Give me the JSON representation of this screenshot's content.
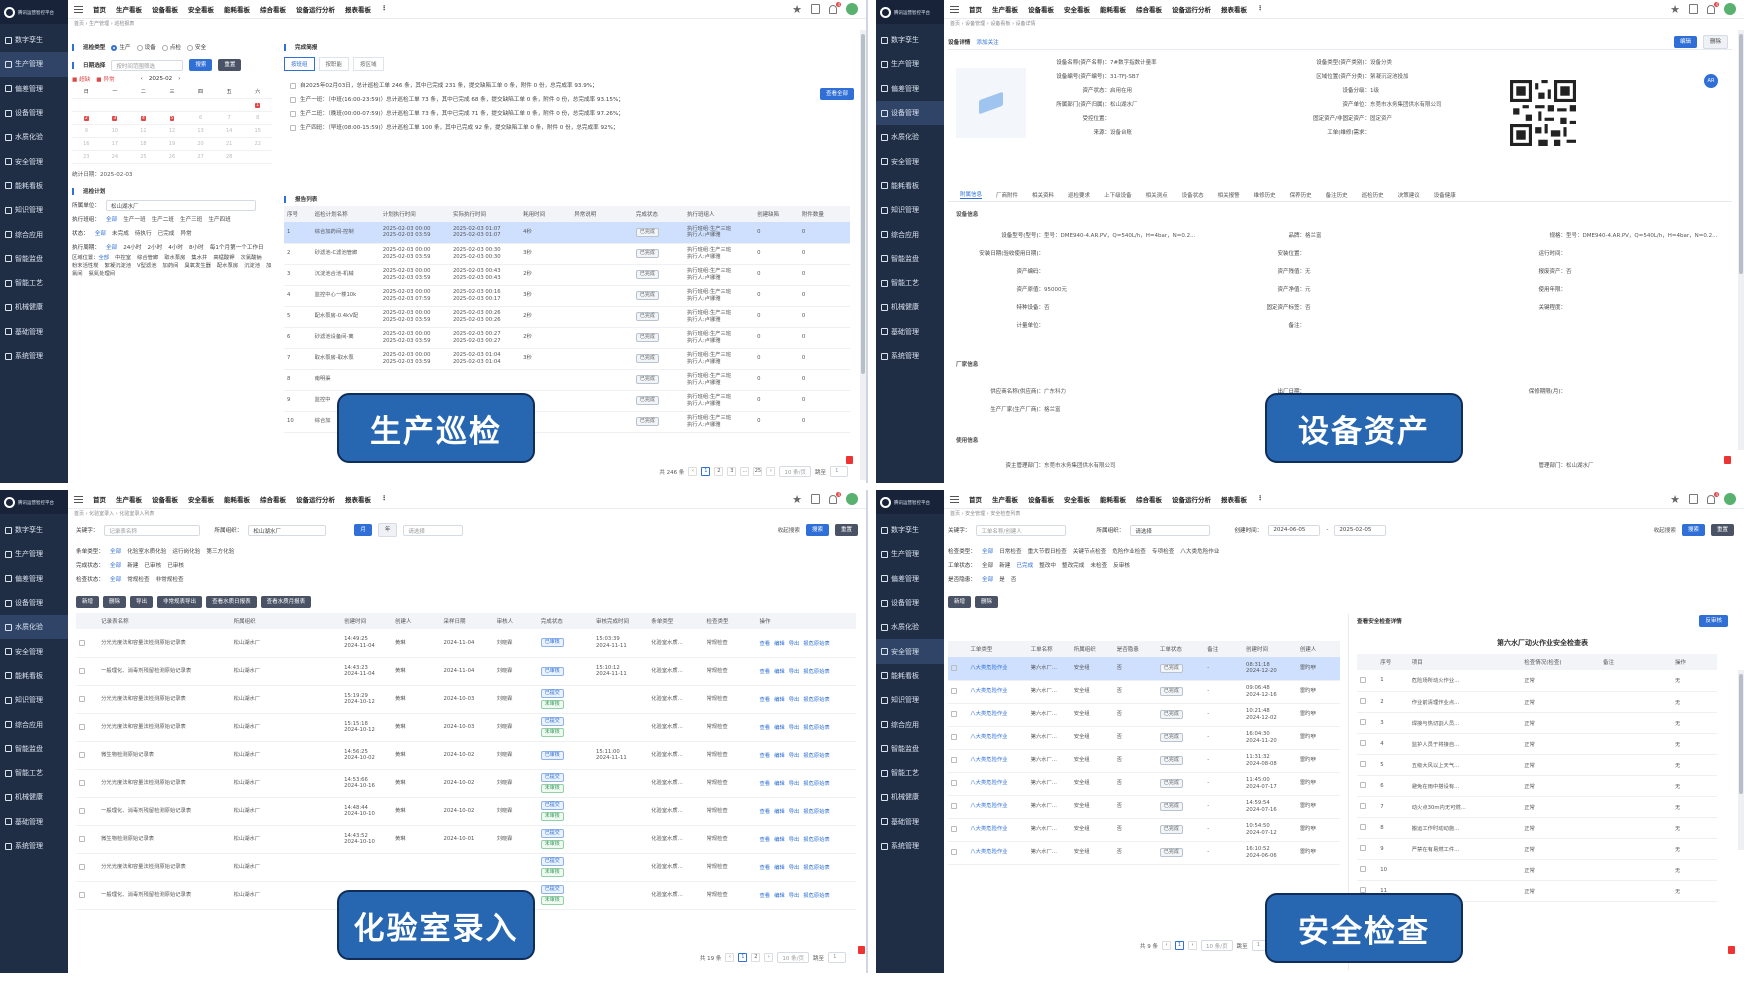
{
  "common": {
    "brand": "腾讯运营智控平台",
    "nav": [
      "数字孪生",
      "生产管理",
      "偏差管理",
      "设备管理",
      "水质化验",
      "安全管理",
      "能耗看板",
      "知识管理",
      "综合应用",
      "智能监盘",
      "智能工艺",
      "机械健康",
      "基础管理",
      "系统管理"
    ],
    "top_menu": [
      "首页",
      "生产看板",
      "设备看板",
      "安全看板",
      "能耗看板",
      "综合看板",
      "设备运行分析",
      "报表看板",
      "⋮"
    ],
    "bell_count": "4"
  },
  "q1": {
    "label": "生产巡检",
    "crumb": "首页 › 生产管理 › 巡检报表",
    "filter_title": "巡检类型",
    "type_opts": [
      "生产",
      "设备",
      "点检",
      "安全"
    ],
    "date_title": "日期选择",
    "date_placeholder": "按时间范围筛选",
    "search": "搜索",
    "reset": "重置",
    "legend": [
      "超缺",
      "异常"
    ],
    "month": "2025-02",
    "weekdays": [
      "日",
      "一",
      "二",
      "三",
      "四",
      "五",
      "六"
    ],
    "days": [
      "",
      "",
      "",
      "",
      "",
      "",
      "1",
      "2",
      "3",
      "4",
      "5",
      "6",
      "7",
      "8",
      "9",
      "10",
      "11",
      "12",
      "13",
      "14",
      "15",
      "16",
      "17",
      "18",
      "19",
      "20",
      "21",
      "22",
      "23",
      "24",
      "25",
      "26",
      "27",
      "28",
      ""
    ],
    "marked_days": [
      "1",
      "2",
      "3",
      "4",
      "5"
    ],
    "selected_date": "统计日期：2025-02-03",
    "plan_title": "巡检计划",
    "org_label": "所属单位：",
    "org_value": "松山湖水厂",
    "team_label": "执行班组：",
    "teams": [
      "全部",
      "生产一班",
      "生产二班",
      "生产三班",
      "生产四班"
    ],
    "state_label": "状态：",
    "states": [
      "全部",
      "未完成",
      "待执行",
      "已完成",
      "异常"
    ],
    "period_label": "执行周期：",
    "periods": [
      "全部",
      "24小时",
      "2小时",
      "4小时",
      "8小时",
      "每1个月第一个工作日"
    ],
    "area_label": "区域位置：",
    "areas": [
      "全部",
      "中控室",
      "综合管廊",
      "取水泵房",
      "集水井",
      "高锰酸钾",
      "次氯酸钠",
      "粉末活性炭",
      "絮凝沉淀池",
      "V型滤池",
      "加药间",
      "臭氧发生器",
      "配水泵房",
      "沉淀池",
      "加氯间",
      "氨氮处理间"
    ],
    "report_title": "完成简报",
    "report_tabs": [
      "按班组",
      "按职能",
      "按区域"
    ],
    "summary_lines": [
      "自2025年02月03日，总计巡检工单 246 条，其中已完成 231 条，提交缺陷工单 0 条，附件 0 份，总完成率 93.9%；",
      "生产一班：（中班(16:00-23:59)）总计巡检工单 73 条，其中已完成 68 条，提交缺陷工单 0 条，附件 0 份，总完成率 93.15%；",
      "生产二班：（晚班(00:00-07:59)）总计巡检工单 73 条，其中已完成 71 条，提交缺陷工单 0 条，附件 0 份，总完成率 97.26%；",
      "生产四班：（早班(08:00-15:59)）总计巡检工单 100 条，其中已完成 92 条，提交缺陷工单 0 条，附件 0 份，总完成率 92%；"
    ],
    "view_all": "查看全部",
    "list_title": "报告列表",
    "columns": [
      "序号",
      "巡检计划名称",
      "计划执行时间",
      "实际执行时间",
      "耗用时间",
      "异常说明",
      "完成状态",
      "执行班组人",
      "创建缺陷",
      "附件数量"
    ],
    "rows": [
      [
        "1",
        "综合加药间-控制",
        "2025-02-03 00:00\n2025-02-03 03:59",
        "2025-02-03 01:07\n2025-02-03 01:07",
        "4秒",
        "",
        "已完成",
        "执行班组:生产三班\n执行人:卢娜雅",
        "0",
        "0"
      ],
      [
        "2",
        "砂滤池-C滤池管廊",
        "2025-02-03 00:00\n2025-02-03 03:59",
        "2025-02-03 00:30\n2025-02-03 00:30",
        "3秒",
        "",
        "已完成",
        "执行班组:生产三班\n执行人:卢娜雅",
        "0",
        "0"
      ],
      [
        "3",
        "沉淀池合池-机械",
        "2025-02-03 00:00\n2025-02-03 03:59",
        "2025-02-03 00:43\n2025-02-03 00:43",
        "2秒",
        "",
        "已完成",
        "执行班组:生产三班\n执行人:卢娜雅",
        "0",
        "0"
      ],
      [
        "4",
        "监控中心一楼10k",
        "2025-02-03 00:00\n2025-02-03 07:59",
        "2025-02-03 00:16\n2025-02-03 00:17",
        "3秒",
        "",
        "已完成",
        "执行班组:生产三班\n执行人:卢娜雅",
        "0",
        "0"
      ],
      [
        "5",
        "配水泵房-0.4kV配",
        "2025-02-03 00:00\n2025-02-03 03:59",
        "2025-02-03 00:26\n2025-02-03 00:26",
        "2秒",
        "",
        "已完成",
        "执行班组:生产三班\n执行人:卢娜雅",
        "0",
        "0"
      ],
      [
        "6",
        "砂滤池设备间-离",
        "2025-02-03 00:00\n2025-02-03 03:59",
        "2025-02-03 00:27\n2025-02-03 00:27",
        "2秒",
        "",
        "已完成",
        "执行班组:生产三班\n执行人:卢娜雅",
        "0",
        "0"
      ],
      [
        "7",
        "取水泵房-取水泵",
        "2025-02-03 00:00\n2025-02-03 03:59",
        "2025-02-03 01:04\n2025-02-03 01:04",
        "3秒",
        "",
        "已完成",
        "执行班组:生产三班\n执行人:卢娜雅",
        "0",
        "0"
      ],
      [
        "8",
        "南明渠",
        "",
        "",
        "",
        "",
        "已完成",
        "执行班组:生产三班\n执行人:卢娜雅",
        "0",
        "0"
      ],
      [
        "9",
        "监控中",
        "",
        "",
        "",
        "",
        "已完成",
        "执行班组:生产三班\n执行人:卢娜雅",
        "0",
        "0"
      ],
      [
        "10",
        "综合加",
        "",
        "",
        "",
        "",
        "已完成",
        "执行班组:生产三班\n执行人:卢娜雅",
        "0",
        "0"
      ]
    ],
    "total": "共 246 条",
    "pages": [
      "1",
      "2",
      "3",
      "…",
      "25"
    ],
    "page_size": "10 条/页",
    "goto": "跳至",
    "goto_page": "1"
  },
  "q2": {
    "label": "设备资产",
    "crumb": "首页 › 设备管理 › 设备看板 › 设备详情",
    "title": "设备详情",
    "add_follow": "添加关注",
    "edit": "编辑",
    "del": "删除",
    "fields_left": [
      [
        "设备名称(资产名称)：",
        "7#数字指数计量率"
      ],
      [
        "设备编号(资产编号)：",
        "31-TFJ-SB7"
      ],
      [
        "资产状态：",
        "启用在用"
      ],
      [
        "所属部门(资产归属)：",
        "松山湖水厂"
      ],
      [
        "受控位置：",
        ""
      ],
      [
        "来源：",
        "设备台账"
      ]
    ],
    "fields_right": [
      [
        "设备类型(资产类别)：",
        "设备分类"
      ],
      [
        "区域位置(资产分类)：",
        "絮凝沉淀池投加"
      ],
      [
        "设备分级：",
        "1级"
      ],
      [
        "资产单位：",
        "东莞市水务集团供水有限公司"
      ],
      [
        "固定资产/非固定资产：",
        "固定资产"
      ],
      [
        "工单(维修)需求：",
        ""
      ]
    ],
    "tabs": [
      "附属信息",
      "厂商附件",
      "相关资料",
      "巡检要求",
      "上下级设备",
      "相关测点",
      "设备状态",
      "相关报警",
      "维修历史",
      "保养历史",
      "备注历史",
      "巡检历史",
      "决策建议",
      "设备健康"
    ],
    "basic_title": "设备信息",
    "basic_rows": [
      [
        [
          "设备型号(型号)：",
          "型号：DME940-4.AR.PV，Q=540L/h，H=4bar，N=0.2..."
        ],
        [
          "品牌：",
          "格兰富"
        ],
        [
          "规格：",
          "型号：DME940-4.AR.PV，Q=540L/h，H=4bar，N=0.2..."
        ]
      ],
      [
        [
          "安装日期(验收使用日期)：",
          ""
        ],
        [
          "安装位置：",
          ""
        ],
        [
          "运行时间：",
          ""
        ]
      ],
      [
        [
          "资产编码：",
          ""
        ],
        [
          "资产残值：",
          "无"
        ],
        [
          "报废资产：",
          "否"
        ]
      ],
      [
        [
          "资产原值：",
          "95000元"
        ],
        [
          "资产净值：",
          "元"
        ],
        [
          "使用年限：",
          ""
        ]
      ],
      [
        [
          "特种设备：",
          "否"
        ],
        [
          "固定资产标签：",
          "否"
        ],
        [
          "关键程度：",
          ""
        ]
      ],
      [
        [
          "计量单位：",
          ""
        ],
        [
          "备注：",
          ""
        ],
        [
          "",
          ""
        ]
      ]
    ],
    "maker_title": "厂家信息",
    "maker_rows": [
      [
        [
          "供应商名称(供应商)：",
          "广东科力"
        ],
        [
          "出厂日期：",
          ""
        ],
        [
          "保修期限(月)：",
          ""
        ]
      ],
      [
        [
          "生产厂家(生产厂商)：",
          "格兰富"
        ],
        [
          "出厂编号：",
          ""
        ],
        [
          "",
          ""
        ]
      ]
    ],
    "usage_title": "使用信息",
    "usage_rows": [
      [
        [
          "资主管理部门：",
          "东莞市水务集团供水有限公司"
        ],
        [
          "",
          ""
        ],
        [
          "管理部门：",
          "松山湖水厂"
        ]
      ]
    ],
    "ar_badge": "AR"
  },
  "q3": {
    "label": "化验室录入",
    "crumb": "首页 › 化验室录入 › 化验室录入列表",
    "kw_label": "关键字：",
    "kw_placeholder": "记录表名称",
    "org_label": "所属组织：",
    "org_value": "松山湖水厂",
    "seg": [
      "月",
      "年"
    ],
    "month_placeholder": "请选择",
    "collapse": "收起搜索",
    "search": "搜索",
    "reset": "重置",
    "f1_label": "条单类型：",
    "f1": [
      "全部",
      "化验室水质化验",
      "运行岗化验",
      "第三方化验"
    ],
    "f2_label": "完成状态：",
    "f2": [
      "全部",
      "新建",
      "已审核",
      "已审核"
    ],
    "f3_label": "检查状态：",
    "f3": [
      "全部",
      "常规检查",
      "非常规检查"
    ],
    "actions": [
      "新增",
      "删除",
      "导出",
      "非常规表导出",
      "查看水质日报表",
      "查看水质月报表"
    ],
    "columns": [
      "",
      "记录表名称",
      "所属组织",
      "创建时间",
      "创建人",
      "采样日期",
      "审核人",
      "完成状态",
      "审核完成时间",
      "条单类型",
      "检查类型",
      "操作"
    ],
    "rows": [
      [
        "分光光度法和容量法检测原始记录表",
        "松山湖水厂",
        "14:49:25\n2024-11-04",
        "黄琳",
        "2024-11-04",
        "刘晓霖",
        "已审核",
        "15:03:39\n2024-11-11",
        "化验室水质...",
        "常规检查",
        "查看 编辑 导出 报危原始表"
      ],
      [
        "一般理化、消毒剂残留检测原始记录表",
        "松山湖水厂",
        "14:43:23\n2024-11-04",
        "黄琳",
        "2024-11-04",
        "刘晓霖",
        "已审核",
        "15:10:12\n2024-11-11",
        "化验室水质...",
        "常规检查",
        "查看 编辑 导出 报危原始表"
      ],
      [
        "分光光度法和容量法检测原始记录表",
        "松山湖水厂",
        "15:19:29\n2024-10-12",
        "黄琳",
        "2024-10-03",
        "刘晓霖",
        "已提交|未审核",
        "",
        "化验室水质...",
        "常规检查",
        "查看 编辑 导出 报危原始表"
      ],
      [
        "分光光度法和容量法检测原始记录表",
        "松山湖水厂",
        "15:15:18\n2024-10-12",
        "黄琳",
        "2024-10-03",
        "刘晓霖",
        "已提交|未审核",
        "",
        "化验室水质...",
        "常规检查",
        "查看 编辑 导出 报危原始表"
      ],
      [
        "微生物检测原始记录表",
        "松山湖水厂",
        "14:56:25\n2024-10-02",
        "黄琳",
        "2024-10-02",
        "刘晓霖",
        "已审核",
        "15:11:00\n2024-11-11",
        "化验室水质...",
        "常规检查",
        "查看 编辑 导出 报危原始表"
      ],
      [
        "分光光度法和容量法检测原始记录表",
        "松山湖水厂",
        "14:53:66\n2024-10-16",
        "黄琳",
        "2024-10-02",
        "刘晓霖",
        "已提交|未审核",
        "",
        "化验室水质...",
        "常规检查",
        "查看 编辑 导出 报危原始表"
      ],
      [
        "一般理化、消毒剂残留检测原始记录表",
        "松山湖水厂",
        "14:48:44\n2024-10-10",
        "黄琳",
        "2024-10-02",
        "刘晓霖",
        "已提交|未审核",
        "",
        "化验室水质...",
        "常规检查",
        "查看 编辑 导出 报危原始表"
      ],
      [
        "微生物检测原始记录表",
        "松山湖水厂",
        "14:43:52\n2024-10-10",
        "黄琳",
        "2024-10-01",
        "刘晓霖",
        "已提交|未审核",
        "",
        "化验室水质...",
        "常规检查",
        "查看 编辑 导出 报危原始表"
      ],
      [
        "分光光度法和容量法检测原始记录表",
        "松山湖水厂",
        "",
        "",
        "",
        "",
        "已提交|未审核",
        "",
        "化验室水质...",
        "常规检查",
        "查看 编辑 导出 报危原始表"
      ],
      [
        "一般理化、消毒剂残留检测原始记录表",
        "松山湖水厂",
        "",
        "",
        "",
        "",
        "已提交|未审核",
        "",
        "化验室水质...",
        "常规检查",
        "查看 编辑 导出 报危原始表"
      ]
    ],
    "total": "共 19 条",
    "pages": [
      "1",
      "2"
    ],
    "page_size": "10 条/页",
    "goto": "跳至",
    "goto_page": "1"
  },
  "q4": {
    "label": "安全检查",
    "crumb": "首页 › 安全管理 › 安全检查列表",
    "kw_label": "关键字：",
    "kw_placeholder": "工单名称/创建人",
    "org_label": "所属组织：",
    "org_value": "请选择",
    "time_label": "创建时间：",
    "date_from": "2024-06-05",
    "date_to": "2025-02-05",
    "collapse": "收起搜索",
    "search": "搜索",
    "reset": "重置",
    "f1_label": "检查类型：",
    "f1": [
      "全部",
      "日常检查",
      "重大节假日检查",
      "关键节点检查",
      "危险作业检查",
      "专项检查",
      "八大类危险作业"
    ],
    "f2_label": "工单状态：",
    "f2": [
      "全部",
      "新建",
      "已完成",
      "整改中",
      "整改完成",
      "未检查",
      "反审核"
    ],
    "f3_label": "是否隐患：",
    "f3": [
      "全部",
      "是",
      "否"
    ],
    "actions": [
      "新增",
      "删除"
    ],
    "columns": [
      "",
      "工单类型",
      "工单名称",
      "所属组织",
      "是否隐患",
      "工单状态",
      "备注",
      "创建时间",
      "创建人"
    ],
    "rows": [
      [
        "八大类危险作业",
        "第六水厂...",
        "安全组",
        "否",
        "已完成",
        "-",
        "08:31:18\n2024-12-20",
        "雷旳咿"
      ],
      [
        "八大类危险作业",
        "第六水厂...",
        "安全组",
        "否",
        "已完成",
        "-",
        "09:06:48\n2024-12-16",
        "雷旳咿"
      ],
      [
        "八大类危险作业",
        "第六水厂...",
        "安全组",
        "否",
        "已完成",
        "-",
        "10:21:48\n2024-12-02",
        "雷旳咿"
      ],
      [
        "八大类危险作业",
        "第六水厂...",
        "安全组",
        "否",
        "已完成",
        "-",
        "16:04:30\n2024-11-20",
        "雷旳咿"
      ],
      [
        "八大类危险作业",
        "第六水厂...",
        "安全组",
        "否",
        "已完成",
        "-",
        "11:31:32\n2024-08-08",
        "雷旳咿"
      ],
      [
        "八大类危险作业",
        "第六水厂...",
        "安全组",
        "否",
        "已完成",
        "-",
        "11:45:00\n2024-07-17",
        "雷旳咿"
      ],
      [
        "八大类危险作业",
        "第六水厂...",
        "安全组",
        "否",
        "已完成",
        "-",
        "14:59:54\n2024-07-16",
        "雷旳咿"
      ],
      [
        "八大类危险作业",
        "第六水厂...",
        "安全组",
        "否",
        "已完成",
        "-",
        "10:54:50\n2024-07-12",
        "雷旳咿"
      ],
      [
        "八大类危险作业",
        "第六水厂...",
        "安全组",
        "否",
        "已完成",
        "-",
        "16:10:52\n2024-06-06",
        "雷旳咿"
      ]
    ],
    "total": "共 9 条",
    "pages": [
      "1"
    ],
    "page_size": "10 条/页",
    "goto": "跳至",
    "goto_page": "1",
    "detail_title": "查看安全检查详情",
    "detail_btn": "反审核",
    "sheet_title": "第六水厂动火作业安全检查表",
    "sheet_cols": [
      "",
      "序号",
      "项目",
      "检查情况(检查)",
      "备注",
      "操作"
    ],
    "sheet_rows": [
      [
        "1",
        "危险场所动火作业...",
        "正常",
        "",
        "无"
      ],
      [
        "2",
        "作业前清理作业点...",
        "正常",
        "",
        "无"
      ],
      [
        "3",
        "焊接与热切割人员...",
        "正常",
        "",
        "无"
      ],
      [
        "4",
        "监护人员于将接自...",
        "正常",
        "",
        "无"
      ],
      [
        "5",
        "五级大风以上天气...",
        "正常",
        "",
        "无"
      ],
      [
        "6",
        "避免在雨中搭设有...",
        "正常",
        "",
        "无"
      ],
      [
        "7",
        "动火点30m内无可燃...",
        "正常",
        "",
        "无"
      ],
      [
        "8",
        "搬运工作时动动施...",
        "正常",
        "",
        "无"
      ],
      [
        "9",
        "严禁在有易燃工件...",
        "正常",
        "",
        "无"
      ],
      [
        "10",
        "",
        "正常",
        "",
        "无"
      ],
      [
        "11",
        "",
        "正常",
        "",
        "无"
      ]
    ]
  }
}
